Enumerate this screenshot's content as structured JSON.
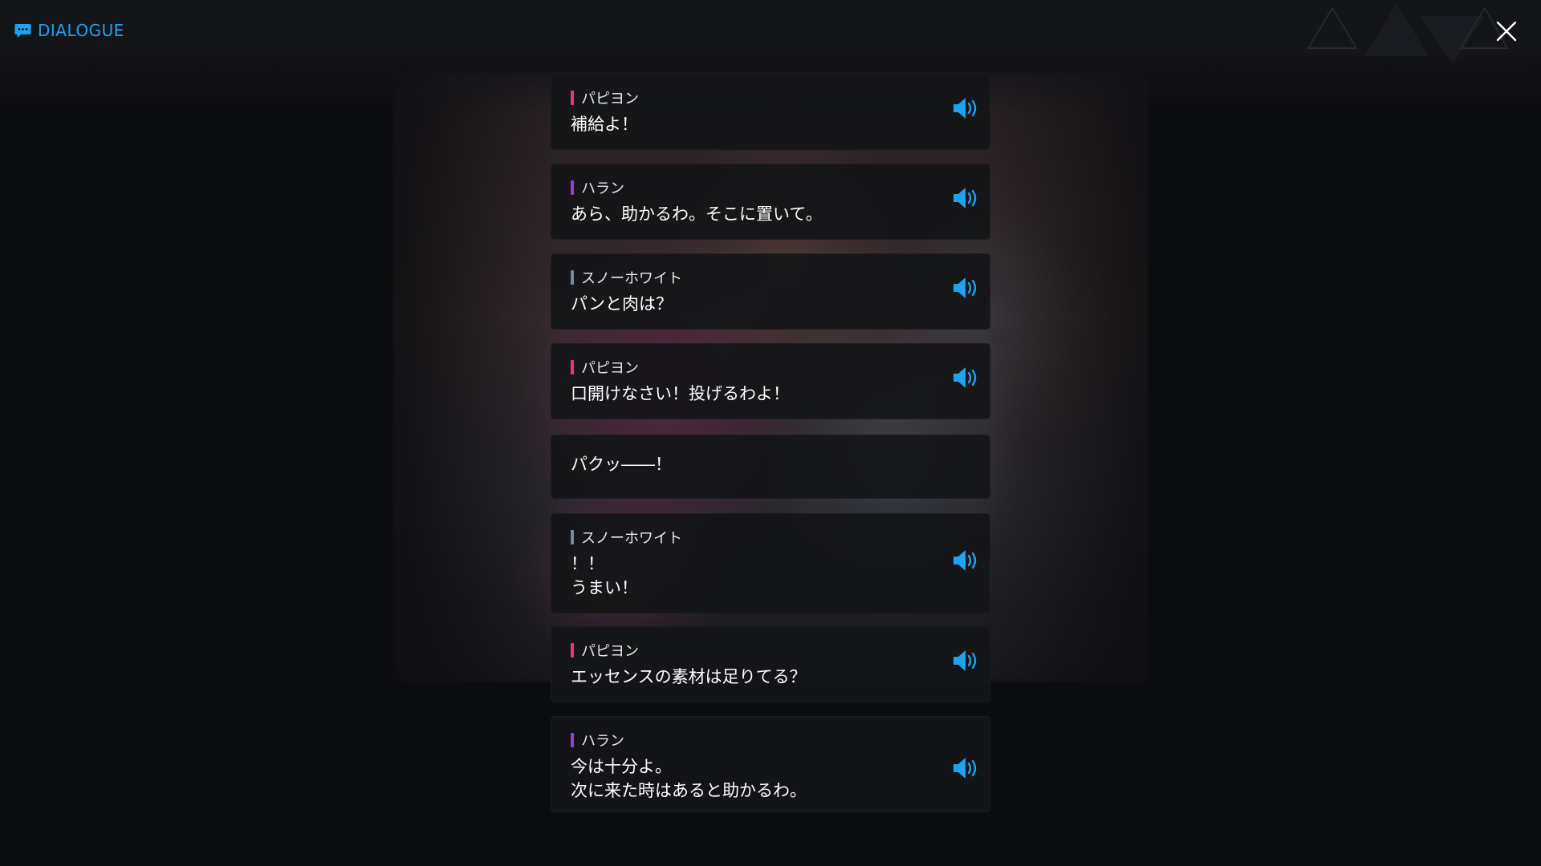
{
  "header": {
    "title": "DIALOGUE",
    "icon": "chat-bubble-icon",
    "accent_color": "#1ea3f0"
  },
  "close": {
    "icon": "close-icon"
  },
  "speaker_colors": {
    "パピヨン": "#e6367a",
    "ハラン": "#9b3fd0",
    "スノーホワイト": "#7a87a8"
  },
  "entries": [
    {
      "speaker": "パピヨン",
      "text": "補給よ！",
      "voice": true
    },
    {
      "speaker": "ハラン",
      "text": "あら、助かるわ。そこに置いて。",
      "voice": true
    },
    {
      "speaker": "スノーホワイト",
      "text": "パンと肉は？",
      "voice": true
    },
    {
      "speaker": "パピヨン",
      "text": "口開けなさい！投げるわよ！",
      "voice": true
    },
    {
      "speaker": "",
      "text": "パクッ――！",
      "voice": false
    },
    {
      "speaker": "スノーホワイト",
      "text": "！！\nうまい！",
      "voice": true
    },
    {
      "speaker": "パピヨン",
      "text": "エッセンスの素材は足りてる？",
      "voice": true
    },
    {
      "speaker": "ハラン",
      "text": "今は十分よ。\n次に来た時はあると助かるわ。",
      "voice": true
    }
  ]
}
